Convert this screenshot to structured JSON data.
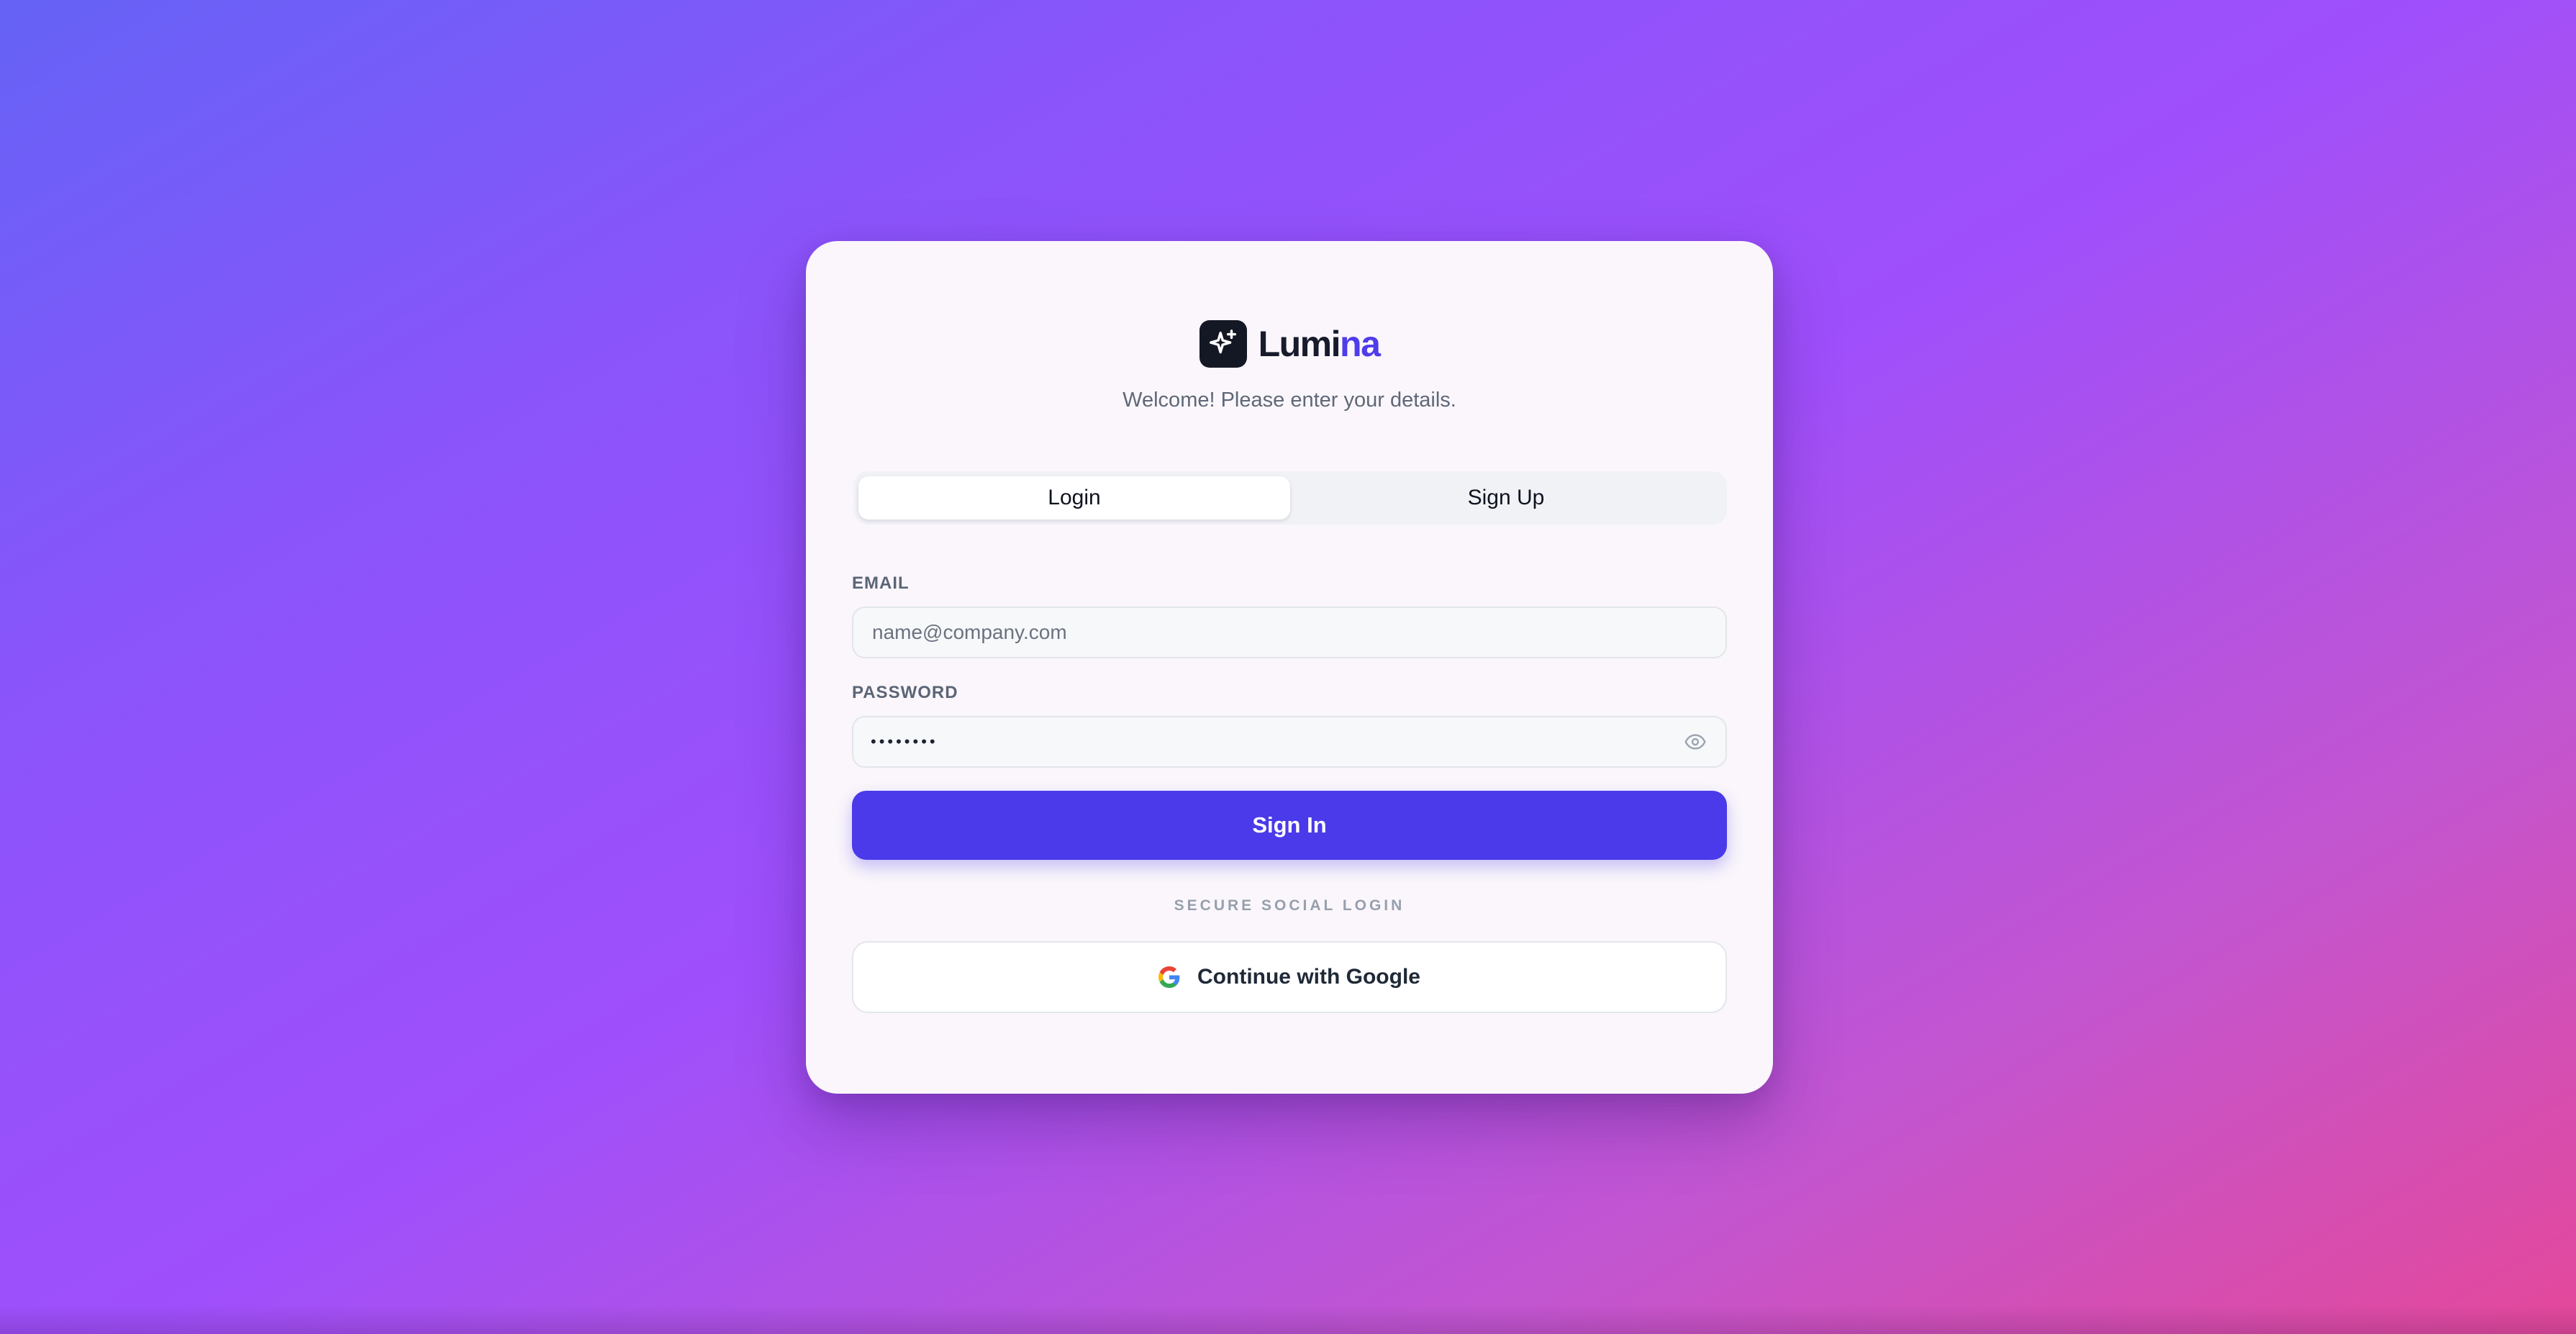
{
  "brand": {
    "name_part1": "Lumi",
    "name_part2": "na",
    "subtitle": "Welcome! Please enter your details.",
    "logo_icon": "sparkles-icon"
  },
  "tabs": [
    {
      "label": "Login",
      "active": true
    },
    {
      "label": "Sign Up",
      "active": false
    }
  ],
  "form": {
    "email_label": "EMAIL",
    "email_placeholder": "name@company.com",
    "email_value": "",
    "password_label": "PASSWORD",
    "password_value": "••••••••",
    "password_toggle_icon": "eye-icon",
    "submit_label": "Sign In"
  },
  "social": {
    "divider": "SECURE SOCIAL LOGIN",
    "google_label": "Continue with Google",
    "google_icon": "google-icon"
  },
  "colors": {
    "accent": "#4a3aea",
    "brand_accent": "#4f3cea",
    "card_bg": "#faf6fb",
    "gradient_start": "#6562f6",
    "gradient_mid": "#9f4ffb",
    "gradient_end": "#e4489a"
  }
}
